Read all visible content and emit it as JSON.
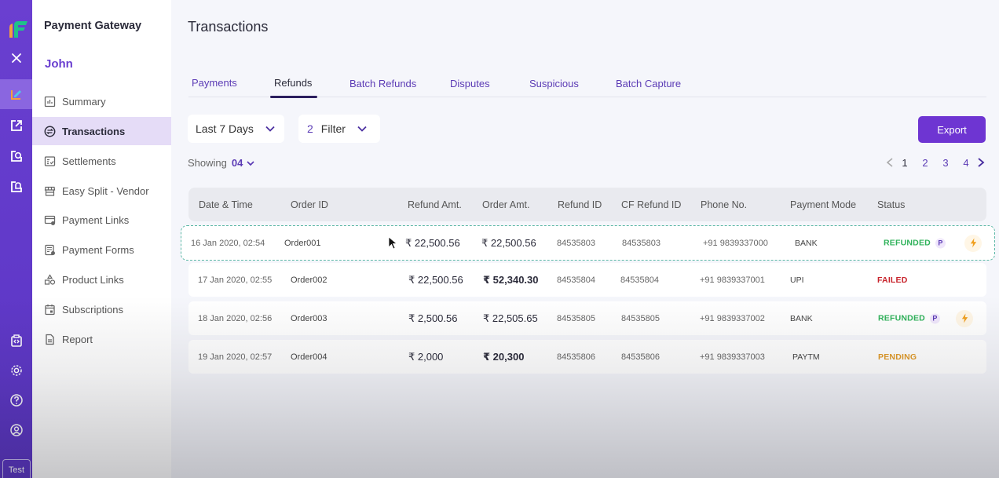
{
  "app": {
    "title": "Payment Gateway",
    "user_name": "John",
    "env_badge": "Test"
  },
  "rail": {
    "icons": [
      "logo-icon",
      "close-icon",
      "transactions-edit-icon",
      "external-link-icon",
      "refresh-doc-icon",
      "document-icon",
      "code-icon",
      "settings-icon",
      "help-icon",
      "profile-icon"
    ],
    "active_index": 2
  },
  "sidebar": {
    "items": [
      {
        "label": "Summary",
        "icon": "bar-chart-icon"
      },
      {
        "label": "Transactions",
        "icon": "exchange-icon",
        "active": true
      },
      {
        "label": "Settlements",
        "icon": "checklist-icon"
      },
      {
        "label": "Easy Split - Vendor",
        "icon": "store-icon"
      },
      {
        "label": "Payment Links",
        "icon": "card-link-icon"
      },
      {
        "label": "Payment Forms",
        "icon": "form-icon"
      },
      {
        "label": "Product Links",
        "icon": "shapes-icon"
      },
      {
        "label": "Subscriptions",
        "icon": "calendar-icon"
      },
      {
        "label": "Report",
        "icon": "file-icon"
      }
    ]
  },
  "main": {
    "title": "Transactions",
    "tabs": [
      {
        "label": "Payments"
      },
      {
        "label": "Refunds",
        "active": true
      },
      {
        "label": "Batch Refunds"
      },
      {
        "label": "Disputes"
      },
      {
        "label": "Suspicious"
      },
      {
        "label": "Batch Capture"
      }
    ],
    "date_filter": "Last 7 Days",
    "filter_count": "2",
    "filter_label": "Filter",
    "export_label": "Export",
    "showing_label": "Showing",
    "showing_value": "04",
    "pagination": {
      "pages": [
        "1",
        "2",
        "3",
        "4"
      ],
      "current": "1"
    }
  },
  "table": {
    "columns": [
      "Date & Time",
      "Order ID",
      "Refund Amt.",
      "Order Amt.",
      "Refund ID",
      "CF Refund ID",
      "Phone No.",
      "Payment Mode",
      "Status"
    ],
    "rows": [
      {
        "date": "16 Jan 2020, 02:54",
        "order_id": "Order001",
        "refund_amt": "₹ 22,500.56",
        "order_amt": "₹ 22,500.56",
        "refund_id": "84535803",
        "cf_refund_id": "84535803",
        "phone": "+91 9839337000",
        "mode": "BANK",
        "status": "REFUNDED",
        "status_color": "#2fb25a",
        "badge": "P",
        "instant": true,
        "hovered": true
      },
      {
        "date": "17 Jan 2020, 02:55",
        "order_id": "Order002",
        "refund_amt": "₹ 22,500.56",
        "order_amt": "₹ 52,340.30",
        "refund_id": "84535804",
        "cf_refund_id": "84535804",
        "phone": "+91 9839337001",
        "mode": "UPI",
        "status": "FAILED",
        "status_color": "#c8242c",
        "badge": "",
        "instant": false
      },
      {
        "date": "18 Jan 2020, 02:56",
        "order_id": "Order003",
        "refund_amt": "₹ 2,500.56",
        "order_amt": "₹ 22,505.65",
        "refund_id": "84535805",
        "cf_refund_id": "84535805",
        "phone": "+91 9839337002",
        "mode": "BANK",
        "status": "REFUNDED",
        "status_color": "#2fb25a",
        "badge": "P",
        "instant": true
      },
      {
        "date": "19 Jan 2020, 02:57",
        "order_id": "Order004",
        "refund_amt": "₹ 2,000",
        "order_amt": "₹ 20,300",
        "refund_id": "84535806",
        "cf_refund_id": "84535806",
        "phone": "+91 9839337003",
        "mode": "PAYTM",
        "status": "PENDING",
        "status_color": "#e09a28",
        "badge": "",
        "instant": false
      }
    ]
  },
  "colors": {
    "brand": "#6a3fd0",
    "accent_button": "#6e35d2",
    "refunded": "#2fb25a",
    "failed": "#c8242c",
    "pending": "#e09a28",
    "instant_bolt": "#f0a020"
  }
}
